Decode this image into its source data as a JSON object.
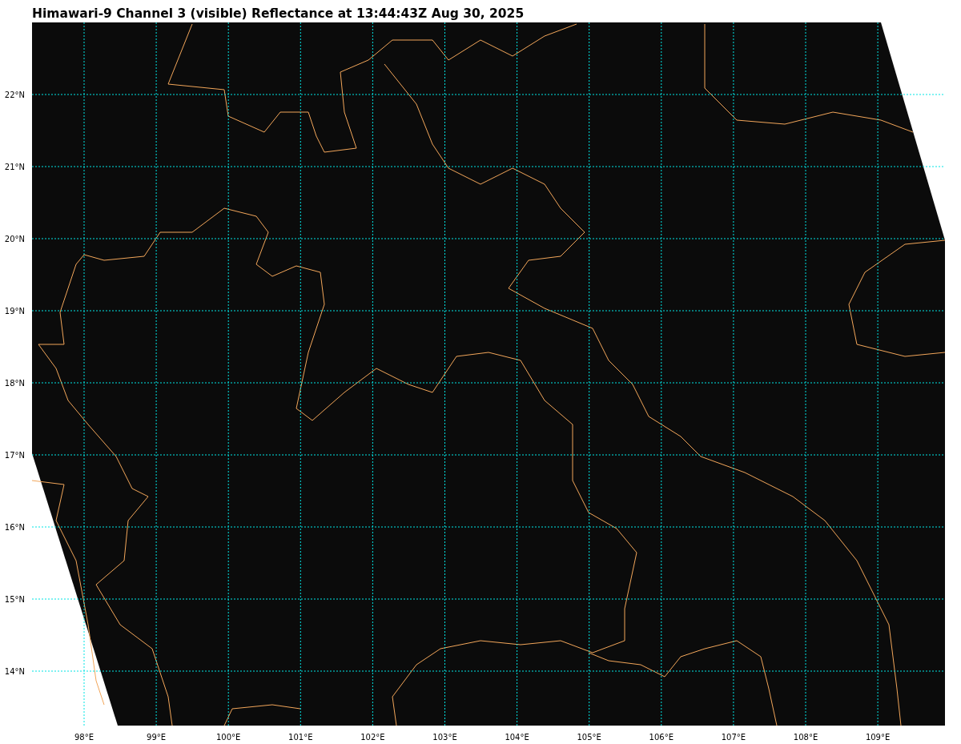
{
  "title": "Himawari-9 Channel 3 (visible) Reflectance at 13:44:43Z Aug 30, 2025",
  "y_ticks": [
    "22°N",
    "21°N",
    "20°N",
    "19°N",
    "18°N",
    "17°N",
    "16°N",
    "15°N",
    "14°N"
  ],
  "x_ticks": [
    "98°E",
    "99°E",
    "100°E",
    "101°E",
    "102°E",
    "103°E",
    "104°E",
    "105°E",
    "106°E",
    "107°E",
    "108°E",
    "109°E"
  ]
}
